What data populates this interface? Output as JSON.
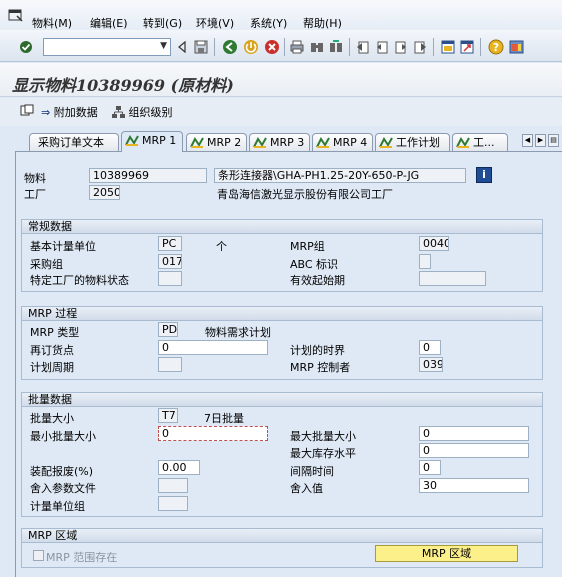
{
  "menu": {
    "items": [
      "物料(M)",
      "编辑(E)",
      "转到(G)",
      "环境(V)",
      "系统(Y)",
      "帮助(H)"
    ]
  },
  "toolbar": {
    "command_value": "",
    "icons": [
      "check-icon",
      "back-icon",
      "save-icon",
      "green-arrow-back-icon",
      "exit-icon",
      "cancel-icon",
      "print-icon",
      "find-icon",
      "find-next-icon",
      "first-page-icon",
      "prev-page-icon",
      "next-page-icon",
      "last-page-icon",
      "new-session-icon",
      "shortcut-icon",
      "help-icon",
      "layout-icon"
    ]
  },
  "title": "显示物料10389969 (原材料)",
  "app_toolbar": {
    "additional_data": "附加数据",
    "org_levels": "组织级别"
  },
  "tabs": [
    "采购订单文本",
    "MRP 1",
    "MRP 2",
    "MRP 3",
    "MRP 4",
    "工作计划",
    "工..."
  ],
  "header": {
    "material_label": "物料",
    "material_value": "10389969",
    "material_desc": "条形连接器\\GHA-PH1.25-20Y-650-P-JG",
    "plant_label": "工厂",
    "plant_value": "2050",
    "plant_desc": "青岛海信激光显示股份有限公司工厂"
  },
  "general": {
    "title": "常规数据",
    "base_uom_label": "基本计量单位",
    "base_uom_value": "PC",
    "base_uom_text": "个",
    "mrp_group_label": "MRP组",
    "mrp_group_value": "0040",
    "purch_group_label": "采购组",
    "purch_group_value": "017",
    "abc_label": "ABC 标识",
    "abc_value": "",
    "plant_status_label": "特定工厂的物料状态",
    "plant_status_value": "",
    "valid_from_label": "有效起始期",
    "valid_from_value": ""
  },
  "mrp_process": {
    "title": "MRP 过程",
    "mrp_type_label": "MRP 类型",
    "mrp_type_value": "PD",
    "mrp_type_text": "物料需求计划",
    "reorder_label": "再订货点",
    "reorder_value": "0",
    "time_fence_label": "计划的时界",
    "time_fence_value": "0",
    "cycle_label": "计划周期",
    "cycle_value": "",
    "controller_label": "MRP 控制者",
    "controller_value": "039"
  },
  "lot_size": {
    "title": "批量数据",
    "lot_size_label": "批量大小",
    "lot_size_value": "T7",
    "lot_size_text": "7日批量",
    "min_lot_label": "最小批量大小",
    "min_lot_value": "0",
    "max_lot_label": "最大批量大小",
    "max_lot_value": "0",
    "max_stock_label": "最大库存水平",
    "max_stock_value": "0",
    "scrap_label": "装配报废(%)",
    "scrap_value": "0.00",
    "takt_label": "间隔时间",
    "takt_value": "0",
    "rounding_profile_label": "舍入参数文件",
    "rounding_profile_value": "",
    "rounding_value_label": "舍入值",
    "rounding_value_value": "30",
    "uom_group_label": "计量单位组",
    "uom_group_value": ""
  },
  "mrp_area": {
    "title": "MRP 区域",
    "checkbox_label": "MRP  范围存在",
    "button_label": "MRP 区域"
  }
}
